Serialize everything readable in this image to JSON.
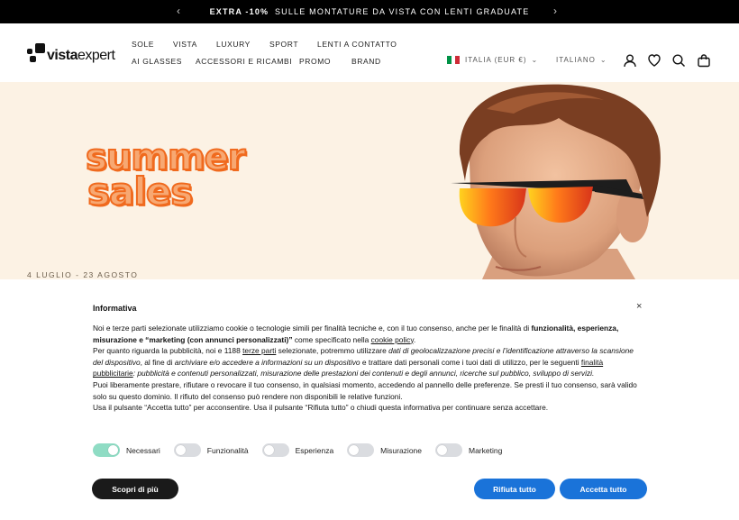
{
  "announcement": {
    "bold": "EXTRA -10%",
    "text": "SULLE MONTATURE DA VISTA CON LENTI GRADUATE",
    "prev_icon": "chevron-left-icon",
    "next_icon": "chevron-right-icon"
  },
  "header": {
    "logo_bold": "vista",
    "logo_light": "expert",
    "nav_row1": [
      "SOLE",
      "VISTA",
      "LUXURY",
      "SPORT",
      "LENTI A CONTATTO"
    ],
    "nav_row2": [
      "AI GLASSES",
      "ACCESSORI E RICAMBI",
      "PROMO",
      "BRAND"
    ],
    "country": "ITALIA (EUR €)",
    "language": "ITALIANO",
    "icons": [
      "account-icon",
      "heart-icon",
      "search-icon",
      "bag-icon"
    ],
    "flag_colors": [
      "#009246",
      "#ffffff",
      "#ce2b37"
    ]
  },
  "hero": {
    "title_line1": "summer",
    "title_line2": "sales",
    "dates": "4 LUGLIO - 23 AGOSTO"
  },
  "cookie": {
    "title": "Informativa",
    "close": "×",
    "p1_a": "Noi e terze parti selezionate utilizziamo cookie o tecnologie simili per finalità tecniche e, con il tuo consenso, anche per le finalità di ",
    "p1_b": "funzionalità, esperienza, misurazione e “marketing (con annunci personalizzati)”",
    "p1_c": " come specificato nella ",
    "p1_link": "cookie policy",
    "p1_d": ".",
    "p2_a": "Per quanto riguarda la pubblicità, noi e 1188 ",
    "p2_link1": "terze parti",
    "p2_b": " selezionate, potremmo utilizzare ",
    "p2_i1": "dati di geolocalizzazione precisi e l’identificazione attraverso la scansione del dispositivo",
    "p2_c": ", al fine di ",
    "p2_i2": "archiviare e/o accedere a informazioni su un dispositivo",
    "p2_d": " e trattare dati personali come i tuoi dati di utilizzo, per le seguenti ",
    "p2_link2": "finalità pubblicitarie",
    "p2_i3": ": pubblicità e contenuti personalizzati, misurazione delle prestazioni dei contenuti e degli annunci, ricerche sul pubblico, sviluppo di servizi.",
    "p3": "Puoi liberamente prestare, rifiutare o revocare il tuo consenso, in qualsiasi momento, accedendo al pannello delle preferenze. Se presti il tuo consenso, sarà valido solo su questo dominio. Il rifiuto del consenso può rendere non disponibili le relative funzioni.",
    "p4": "Usa il pulsante “Accetta tutto” per acconsentire. Usa il pulsante “Rifiuta tutto” o chiudi questa informativa per continuare senza accettare.",
    "toggles": [
      {
        "label": "Necessari",
        "on": true
      },
      {
        "label": "Funzionalità",
        "on": false
      },
      {
        "label": "Esperienza",
        "on": false
      },
      {
        "label": "Misurazione",
        "on": false
      },
      {
        "label": "Marketing",
        "on": false
      }
    ],
    "btn_more": "Scopri di più",
    "btn_reject": "Rifiuta tutto",
    "btn_accept": "Accetta tutto",
    "accent": "#1a73d9"
  }
}
